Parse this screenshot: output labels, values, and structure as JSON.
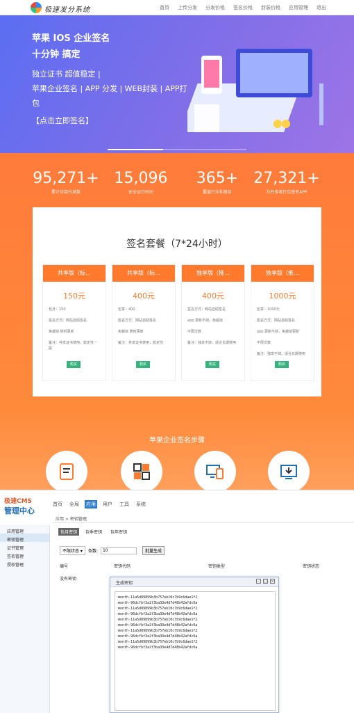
{
  "nav": {
    "brand": "极速发分系统",
    "links": [
      "首页",
      "上传分发",
      "分发价格",
      "签名价格",
      "封装价格",
      "应用管理",
      "退出"
    ]
  },
  "hero": {
    "line1": "苹果 IOS 企业签名",
    "line2": "十分钟 搞定",
    "line3": "独立证书 超值稳定 |",
    "line4": "苹果企业签名 | APP 分发 | WEB封装 | APP打",
    "line5": "包",
    "cta": "【点击立即签名】"
  },
  "stats": [
    {
      "value": "95,271+",
      "label": "累计应用分发数"
    },
    {
      "value": "15,096",
      "label": "安全运行时间"
    },
    {
      "value": "365+",
      "label": "覆盖行业和类目"
    },
    {
      "value": "27,321+",
      "label": "为开发者打包签名APP"
    }
  ],
  "plans": {
    "title": "签名套餐（7*24小时）",
    "cards": [
      {
        "header": "共享版（标…",
        "price": "150元",
        "lines": [
          "包月：150",
          "签名方式：网站自助签名",
          "免越狱 随时更新",
          "备注：共享证书使用，稳定性一般"
        ],
        "button": "购买"
      },
      {
        "header": "共享版（标…",
        "price": "400元",
        "lines": [
          "包季：400",
          "签名方式：网站自助签名",
          "免越狱 随时更新",
          "备注：共享证书使用，稳定性"
        ],
        "button": "购买"
      },
      {
        "header": "独享版（推…",
        "price": "400元",
        "lines": [
          "签名方式：网站自助签名",
          "app 更新不掉，免越狱",
          "不限次数",
          "备注：独享不掉，适合长期使用"
        ],
        "button": "购买"
      },
      {
        "header": "独享版（推…",
        "price": "1000元",
        "lines": [
          "包季：1000元",
          "签名方式：网站自助签名",
          "app 更新不掉，免越狱更新",
          "不限次数",
          "备注：独享不掉，适合长期使用"
        ],
        "button": "购买"
      }
    ]
  },
  "steps": {
    "title": "苹果企业签名步骤"
  },
  "admin": {
    "logo_top": "极速CMS",
    "logo_bottom": "管理中心",
    "tabs": [
      "首页",
      "全局",
      "应用",
      "用户",
      "工具",
      "系统"
    ],
    "active_tab": "应用",
    "sidebar": [
      "应用管理",
      "密钥管理",
      "证书管理",
      "签名管理",
      "授权管理"
    ],
    "breadcrumb": "应用 > 密钥管理",
    "subtabs": [
      "包月密钥",
      "包季密钥",
      "包年密钥"
    ],
    "filter_select": "不限状态",
    "filter_label": "条数:",
    "filter_value": "10",
    "generate_button": "批量生成",
    "columns": [
      "编号",
      "密钥代码",
      "密钥类型",
      "密钥状态"
    ],
    "empty_text": "没有密钥",
    "modal_title": "生成密钥",
    "keys": "month-11a5d09899b3b757eb10c7b9c6dae1f2\nmonth-96dcfbf3a2f3ba33e4d7d48b42afdc6a\nmonth-11a5d09899b3b757eb10c7b9c6dae1f2\nmonth-96dcfbf3a2f3ba33e4d7d48b42afdc6a\nmonth-11a5d09899b3b757eb10c7b9c6dae1f2\nmonth-96dcfbf3a2f3ba33e4d7d48b42afdc6a\nmonth-11a5d09899b3b757eb10c7b9c6dae1f2\nmonth-96dcfbf3a2f3ba33e4d7d48b42afdc6a\nmonth-11a5d09899b3b757eb10c7b9c6dae1f2\nmonth-96dcfbf3a2f3ba33e4d7d48b42afdc6a"
  },
  "colors": {
    "hero": "#6b6ef0",
    "orange": "#ff7a2d",
    "green": "#36b37e",
    "admin_blue": "#2b7bd0"
  }
}
